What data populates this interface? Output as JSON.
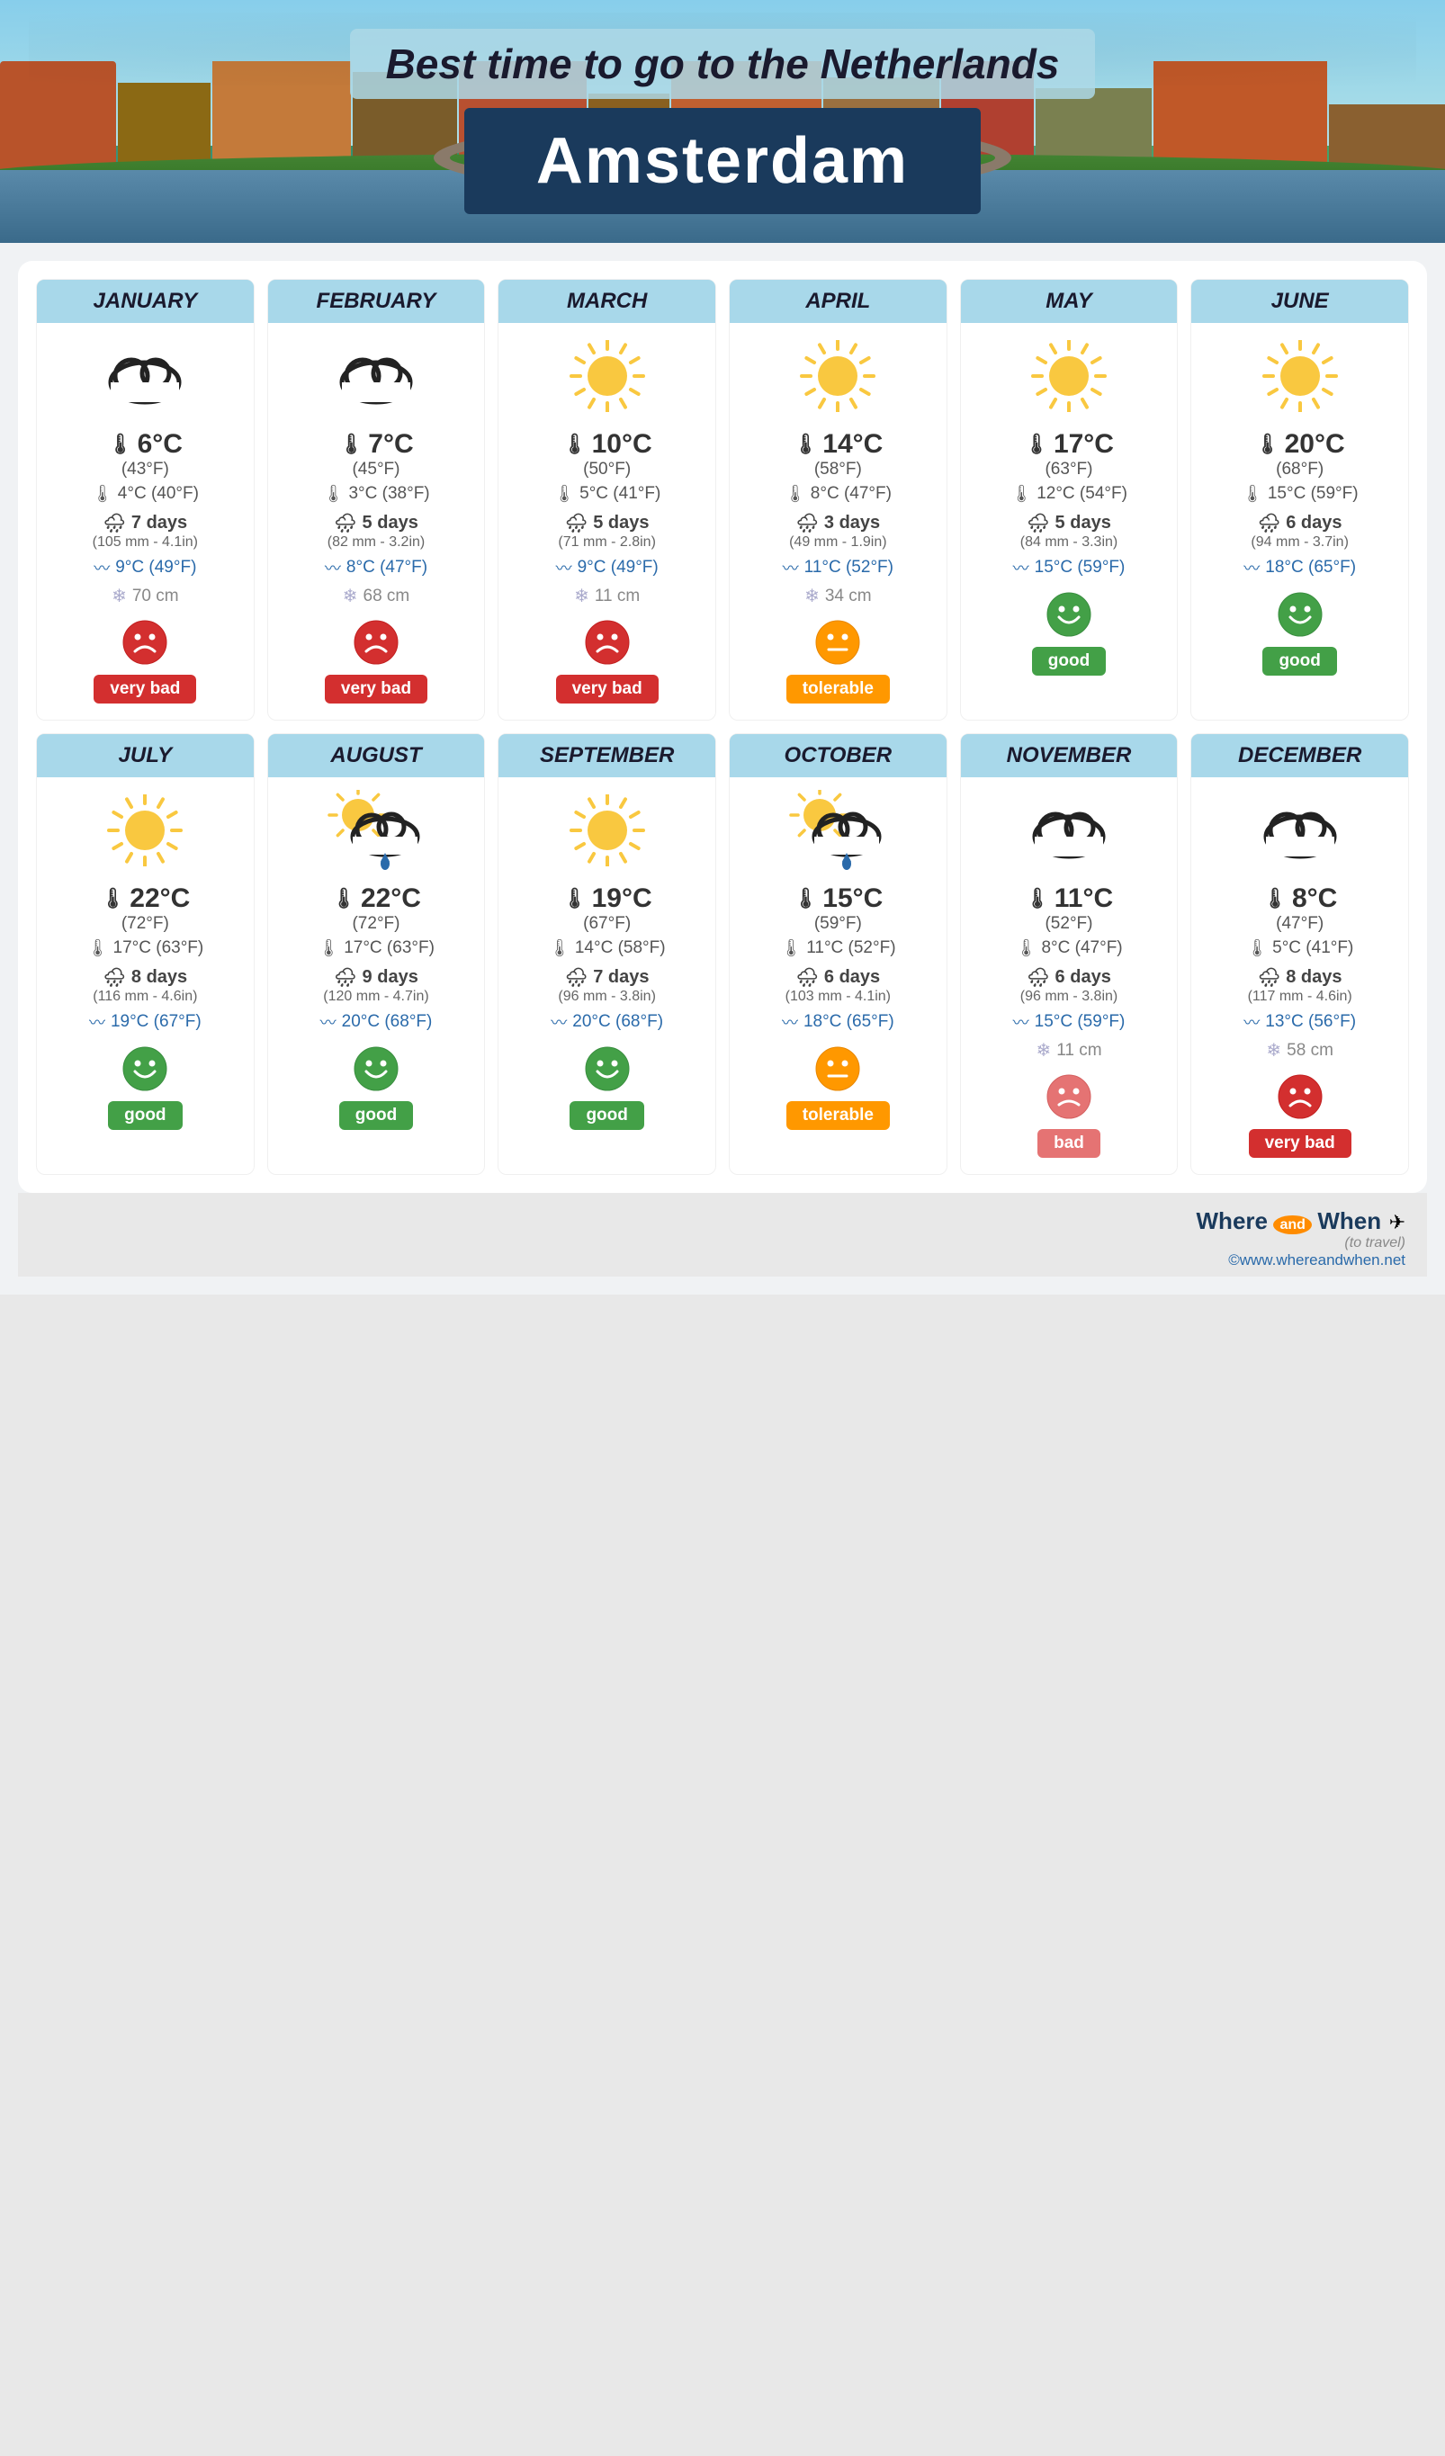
{
  "header": {
    "title": "Best time to go to the Netherlands",
    "city": "Amsterdam"
  },
  "months": [
    {
      "name": "JANUARY",
      "icon": "cloud",
      "temp_high_c": "6°C",
      "temp_high_f": "(43°F)",
      "temp_low": "4°C (40°F)",
      "rain_days": "7 days",
      "rain_detail": "(105 mm - 4.1in)",
      "sea": "9°C (49°F)",
      "snow": "70 cm",
      "rating": "very bad",
      "face": "very-bad"
    },
    {
      "name": "FEBRUARY",
      "icon": "cloud",
      "temp_high_c": "7°C",
      "temp_high_f": "(45°F)",
      "temp_low": "3°C (38°F)",
      "rain_days": "5 days",
      "rain_detail": "(82 mm - 3.2in)",
      "sea": "8°C (47°F)",
      "snow": "68 cm",
      "rating": "very bad",
      "face": "very-bad"
    },
    {
      "name": "MARCH",
      "icon": "sun",
      "temp_high_c": "10°C",
      "temp_high_f": "(50°F)",
      "temp_low": "5°C (41°F)",
      "rain_days": "5 days",
      "rain_detail": "(71 mm - 2.8in)",
      "sea": "9°C (49°F)",
      "snow": "11 cm",
      "rating": "very bad",
      "face": "very-bad"
    },
    {
      "name": "APRIL",
      "icon": "sun",
      "temp_high_c": "14°C",
      "temp_high_f": "(58°F)",
      "temp_low": "8°C (47°F)",
      "rain_days": "3 days",
      "rain_detail": "(49 mm - 1.9in)",
      "sea": "11°C (52°F)",
      "snow": "34 cm",
      "rating": "tolerable",
      "face": "tolerable"
    },
    {
      "name": "MAY",
      "icon": "sun",
      "temp_high_c": "17°C",
      "temp_high_f": "(63°F)",
      "temp_low": "12°C (54°F)",
      "rain_days": "5 days",
      "rain_detail": "(84 mm - 3.3in)",
      "sea": "15°C (59°F)",
      "snow": null,
      "rating": "good",
      "face": "good"
    },
    {
      "name": "JUNE",
      "icon": "sun",
      "temp_high_c": "20°C",
      "temp_high_f": "(68°F)",
      "temp_low": "15°C (59°F)",
      "rain_days": "6 days",
      "rain_detail": "(94 mm - 3.7in)",
      "sea": "18°C (65°F)",
      "snow": null,
      "rating": "good",
      "face": "good"
    },
    {
      "name": "JULY",
      "icon": "sun",
      "temp_high_c": "22°C",
      "temp_high_f": "(72°F)",
      "temp_low": "17°C (63°F)",
      "rain_days": "8 days",
      "rain_detail": "(116 mm - 4.6in)",
      "sea": "19°C (67°F)",
      "snow": null,
      "rating": "good",
      "face": "good"
    },
    {
      "name": "AUGUST",
      "icon": "partly-cloudy-rain",
      "temp_high_c": "22°C",
      "temp_high_f": "(72°F)",
      "temp_low": "17°C (63°F)",
      "rain_days": "9 days",
      "rain_detail": "(120 mm - 4.7in)",
      "sea": "20°C (68°F)",
      "snow": null,
      "rating": "good",
      "face": "good"
    },
    {
      "name": "SEPTEMBER",
      "icon": "sun",
      "temp_high_c": "19°C",
      "temp_high_f": "(67°F)",
      "temp_low": "14°C (58°F)",
      "rain_days": "7 days",
      "rain_detail": "(96 mm - 3.8in)",
      "sea": "20°C (68°F)",
      "snow": null,
      "rating": "good",
      "face": "good"
    },
    {
      "name": "OCTOBER",
      "icon": "partly-cloudy-rain",
      "temp_high_c": "15°C",
      "temp_high_f": "(59°F)",
      "temp_low": "11°C (52°F)",
      "rain_days": "6 days",
      "rain_detail": "(103 mm - 4.1in)",
      "sea": "18°C (65°F)",
      "snow": null,
      "rating": "tolerable",
      "face": "tolerable"
    },
    {
      "name": "NOVEMBER",
      "icon": "cloud",
      "temp_high_c": "11°C",
      "temp_high_f": "(52°F)",
      "temp_low": "8°C (47°F)",
      "rain_days": "6 days",
      "rain_detail": "(96 mm - 3.8in)",
      "sea": "15°C (59°F)",
      "snow": "11 cm",
      "rating": "bad",
      "face": "bad"
    },
    {
      "name": "DECEMBER",
      "icon": "cloud",
      "temp_high_c": "8°C",
      "temp_high_f": "(47°F)",
      "temp_low": "5°C (41°F)",
      "rain_days": "8 days",
      "rain_detail": "(117 mm - 4.6in)",
      "sea": "13°C (56°F)",
      "snow": "58 cm",
      "rating": "very bad",
      "face": "very-bad"
    }
  ],
  "footer": {
    "brand": "Where",
    "and": "and",
    "when": "When",
    "tagline": "to travel",
    "url": "©www.whereandwhen.net"
  }
}
